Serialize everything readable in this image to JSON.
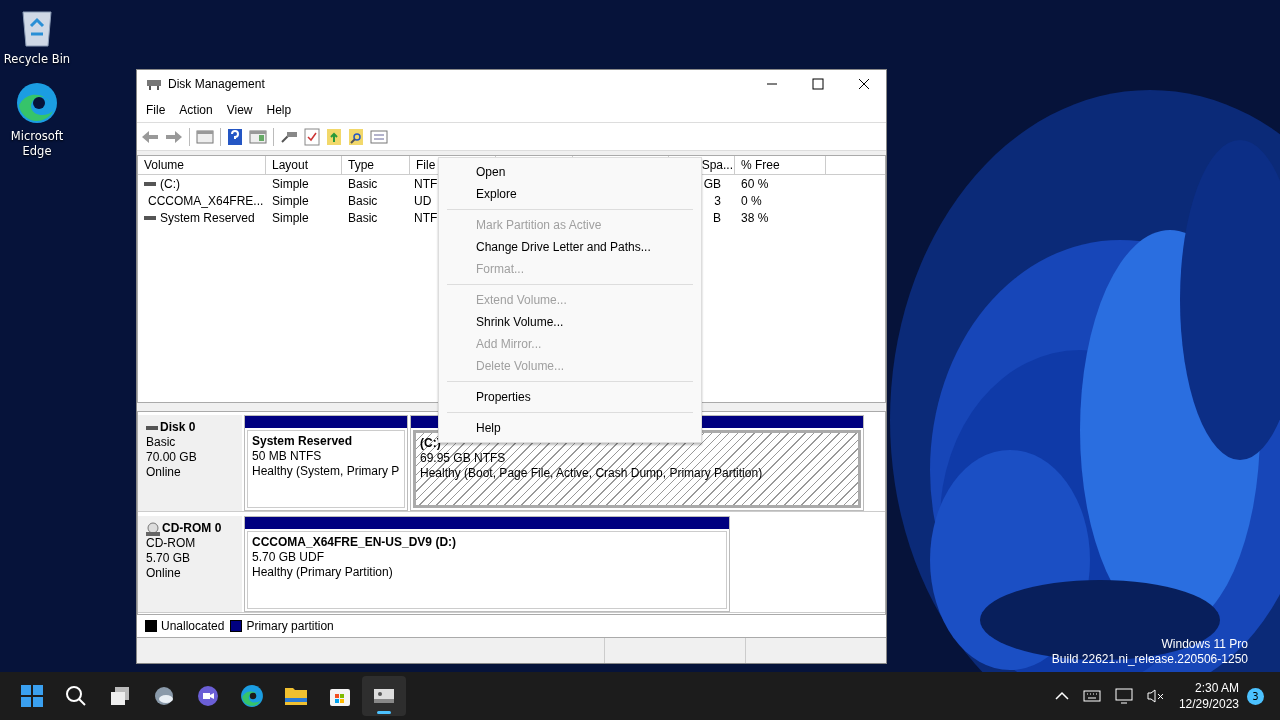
{
  "desktop_icons": [
    {
      "label": "Recycle Bin",
      "kind": "bin"
    },
    {
      "label": "Microsoft Edge",
      "kind": "edge"
    }
  ],
  "window": {
    "title": "Disk Management"
  },
  "menu_bar": [
    "File",
    "Action",
    "View",
    "Help"
  ],
  "volume_table": {
    "columns": [
      {
        "label": "Volume"
      },
      {
        "label": "Layout"
      },
      {
        "label": "Type"
      },
      {
        "label": "File"
      },
      {},
      {},
      {
        "label": "Spa..."
      },
      {
        "label": "% Free"
      }
    ],
    "rows": [
      {
        "kind": "drive",
        "cells": [
          "(C:)",
          "Simple",
          "Basic",
          "NTF",
          null,
          null,
          "GB",
          "60 %"
        ]
      },
      {
        "kind": "cd",
        "cells": [
          "CCCOMA_X64FRE...",
          "Simple",
          "Basic",
          "UD",
          null,
          null,
          "3",
          "0 %"
        ]
      },
      {
        "kind": "drive",
        "cells": [
          "System Reserved",
          "Simple",
          "Basic",
          "NTF",
          null,
          null,
          "B",
          "38 %"
        ]
      }
    ]
  },
  "disks": [
    {
      "name": "Disk 0",
      "kind": "disk",
      "details": [
        "Basic",
        "70.00 GB",
        "Online"
      ],
      "partitions": [
        {
          "title": "System Reserved",
          "size": "50 MB NTFS",
          "status": "Healthy (System, Primary P",
          "selected": false
        },
        {
          "title": "(C:)",
          "size": "69.95 GB NTFS",
          "status": "Healthy (Boot, Page File, Active, Crash Dump, Primary Partition)",
          "selected": true
        }
      ]
    },
    {
      "name": "CD-ROM 0",
      "kind": "cd",
      "details": [
        "CD-ROM",
        "5.70 GB",
        "Online"
      ],
      "partitions": [
        {
          "title": "CCCOMA_X64FRE_EN-US_DV9  (D:)",
          "size": "5.70 GB UDF",
          "status": "Healthy (Primary Partition)",
          "selected": false
        }
      ]
    }
  ],
  "legend": [
    {
      "label": "Unallocated",
      "color": "#000000"
    },
    {
      "label": "Primary partition",
      "color": "#000080"
    }
  ],
  "context_menu": [
    {
      "kind": "item",
      "label": "Open",
      "disabled": false
    },
    {
      "kind": "item",
      "label": "Explore",
      "disabled": false
    },
    {
      "kind": "separator"
    },
    {
      "kind": "item",
      "label": "Mark Partition as Active",
      "disabled": true
    },
    {
      "kind": "item",
      "label": "Change Drive Letter and Paths...",
      "disabled": false
    },
    {
      "kind": "item",
      "label": "Format...",
      "disabled": true
    },
    {
      "kind": "separator"
    },
    {
      "kind": "item",
      "label": "Extend Volume...",
      "disabled": true
    },
    {
      "kind": "item",
      "label": "Shrink Volume...",
      "disabled": false
    },
    {
      "kind": "item",
      "label": "Add Mirror...",
      "disabled": true
    },
    {
      "kind": "item",
      "label": "Delete Volume...",
      "disabled": true
    },
    {
      "kind": "separator"
    },
    {
      "kind": "item",
      "label": "Properties",
      "disabled": false
    },
    {
      "kind": "separator"
    },
    {
      "kind": "item",
      "label": "Help",
      "disabled": false
    }
  ],
  "os_watermark": [
    "Windows 11 Pro",
    "Build 22621.ni_release.220506-1250"
  ],
  "taskbar": {
    "apps": [
      {
        "kind": "start",
        "active": false
      },
      {
        "kind": "search",
        "active": false
      },
      {
        "kind": "taskview",
        "active": false
      },
      {
        "kind": "widgets",
        "active": false
      },
      {
        "kind": "chat",
        "active": false
      },
      {
        "kind": "edge",
        "active": false
      },
      {
        "kind": "explorer",
        "active": false
      },
      {
        "kind": "store",
        "active": false
      },
      {
        "kind": "diskmgmt",
        "active": true
      }
    ],
    "time": "2:30 AM",
    "date": "12/29/2023",
    "notifications": "3"
  }
}
